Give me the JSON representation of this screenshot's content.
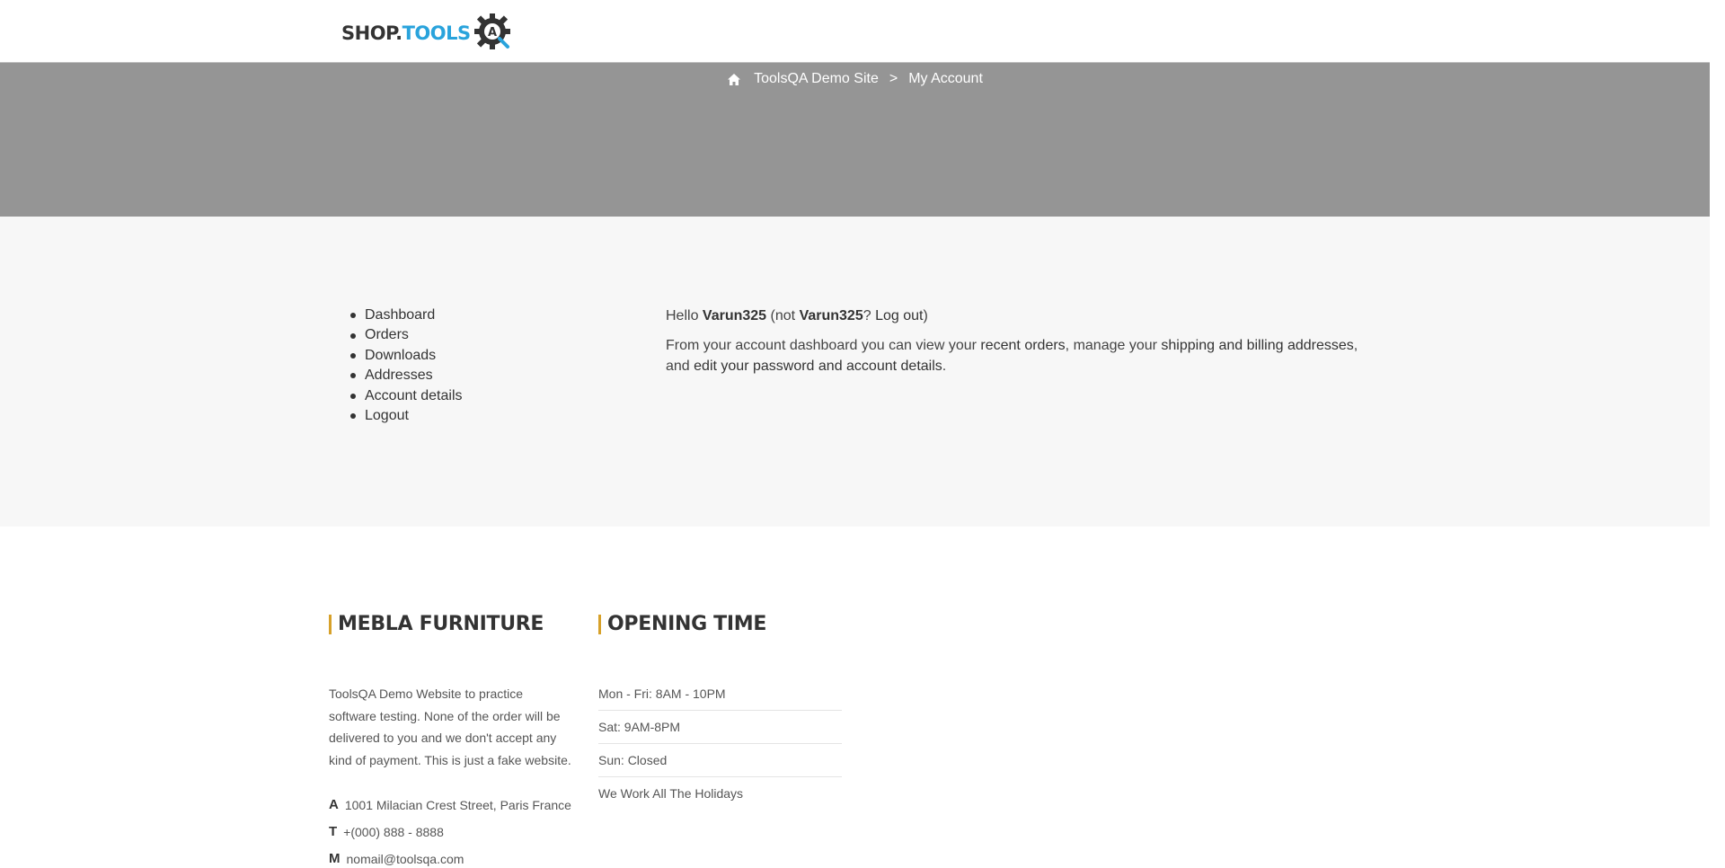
{
  "header": {
    "logo": {
      "part1": "SHOP.",
      "part2": "TOOLS",
      "icon": "gear-qa-icon"
    }
  },
  "breadcrumb": {
    "home_icon": "home-icon",
    "site": "ToolsQA Demo Site",
    "separator": ">",
    "current": "My Account"
  },
  "account_nav": {
    "items": [
      {
        "label": "Dashboard"
      },
      {
        "label": "Orders"
      },
      {
        "label": "Downloads"
      },
      {
        "label": "Addresses"
      },
      {
        "label": "Account details"
      },
      {
        "label": "Logout"
      }
    ]
  },
  "dashboard": {
    "hello": "Hello",
    "username": "Varun325",
    "not": "(not",
    "username2": "Varun325",
    "qmark": "?",
    "logout_link": "Log out",
    "close_paren": ")",
    "intro": "From your account dashboard you can view your",
    "recent_orders": "recent orders",
    "manage": ", manage your",
    "addresses_link": "shipping and billing addresses",
    "and_edit": ", and",
    "password_link": "edit your password and account details",
    "period": "."
  },
  "footer": {
    "about": {
      "title": "MEBLA FURNITURE",
      "text": "ToolsQA Demo Website to practice software testing. None of the order will be delivered to you and we don't accept any kind of payment. This is just a fake website.",
      "address_label": "A",
      "address": "1001 Milacian Crest Street, Paris France",
      "phone_label": "T",
      "phone": "+(000) 888 - 8888",
      "mail_label": "M",
      "mail": "nomail@toolsqa.com"
    },
    "hours": {
      "title": "OPENING TIME",
      "items": [
        "Mon - Fri: 8AM - 10PM",
        "Sat: 9AM-8PM",
        "Sun: Closed",
        "We Work All The Holidays"
      ]
    }
  },
  "colors": {
    "banner": "#959595",
    "main_bg": "#f7f7f7",
    "accent": "#d7a12a",
    "logo_blue": "#29a3dc"
  }
}
